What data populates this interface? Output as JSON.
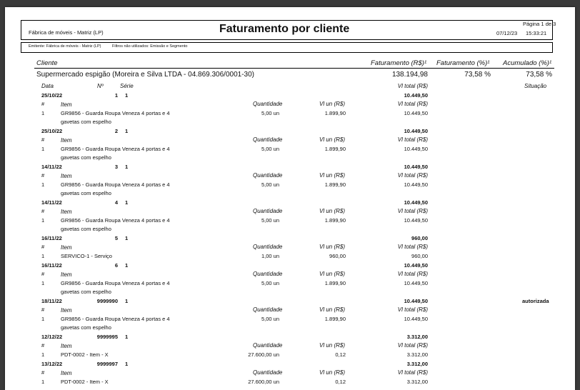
{
  "header": {
    "company": "Fábrica de móveis - Matriz (LP)",
    "title": "Faturamento por cliente",
    "page": "Página 1 de 3",
    "date": "07/12/23",
    "time": "15:33:21"
  },
  "filters": {
    "emitente": "Emitente: Fábrica de móveis - Matriz (LP)",
    "unused": "Filtros não utilizados: Emissão e Segmento"
  },
  "columns": {
    "cliente": "Cliente",
    "faturamento_rs": "Faturamento (R$)¹",
    "faturamento_pct": "Faturamento (%)¹",
    "acumulado_pct": "Acumulado (%)¹"
  },
  "client_row": {
    "name": "Supermercado espigão (Moreira e Silva LTDA - 04.869.306/0001-30)",
    "faturamento": "138.194,98",
    "faturamento_pct": "73,58 %",
    "acumulado_pct": "73,58 %"
  },
  "invoice_header": {
    "data": "Data",
    "numero": "Nº",
    "serie": "Série",
    "vl_total": "Vl total (R$)",
    "situacao": "Situação"
  },
  "item_header": {
    "num": "#",
    "item": "Item",
    "quantidade": "Quantidade",
    "vl_un": "Vl un (R$)",
    "vl_total": "Vl total (R$)"
  },
  "invoices": [
    {
      "date": "25/10/22",
      "number": "1",
      "serie": "1",
      "total": "10.449,50",
      "status": "",
      "items": [
        {
          "n": "1",
          "desc": "GR9856 - Guarda Roupa Veneza 4 portas e 4",
          "desc2": "gavetas com espelho",
          "qty": "5,00 un",
          "unit": "1.899,90",
          "total": "10.449,50"
        }
      ]
    },
    {
      "date": "25/10/22",
      "number": "2",
      "serie": "1",
      "total": "10.449,50",
      "status": "",
      "items": [
        {
          "n": "1",
          "desc": "GR9856 - Guarda Roupa Veneza 4 portas e 4",
          "desc2": "gavetas com espelho",
          "qty": "5,00 un",
          "unit": "1.899,90",
          "total": "10.449,50"
        }
      ]
    },
    {
      "date": "14/11/22",
      "number": "3",
      "serie": "1",
      "total": "10.449,50",
      "status": "",
      "items": [
        {
          "n": "1",
          "desc": "GR9856 - Guarda Roupa Veneza 4 portas e 4",
          "desc2": "gavetas com espelho",
          "qty": "5,00 un",
          "unit": "1.899,90",
          "total": "10.449,50"
        }
      ]
    },
    {
      "date": "14/11/22",
      "number": "4",
      "serie": "1",
      "total": "10.449,50",
      "status": "",
      "items": [
        {
          "n": "1",
          "desc": "GR9856 - Guarda Roupa Veneza 4 portas e 4",
          "desc2": "gavetas com espelho",
          "qty": "5,00 un",
          "unit": "1.899,90",
          "total": "10.449,50"
        }
      ]
    },
    {
      "date": "16/11/22",
      "number": "5",
      "serie": "1",
      "total": "960,00",
      "status": "",
      "items": [
        {
          "n": "1",
          "desc": "SERVICO-1 - Serviço",
          "desc2": "",
          "qty": "1,00 un",
          "unit": "960,00",
          "total": "960,00"
        }
      ]
    },
    {
      "date": "16/11/22",
      "number": "6",
      "serie": "1",
      "total": "10.449,50",
      "status": "",
      "items": [
        {
          "n": "1",
          "desc": "GR9856 - Guarda Roupa Veneza 4 portas e 4",
          "desc2": "gavetas com espelho",
          "qty": "5,00 un",
          "unit": "1.899,90",
          "total": "10.449,50"
        }
      ]
    },
    {
      "date": "18/11/22",
      "number": "9999990",
      "serie": "1",
      "total": "10.449,50",
      "status": "autorizada",
      "items": [
        {
          "n": "1",
          "desc": "GR9856 - Guarda Roupa Veneza 4 portas e 4",
          "desc2": "gavetas com espelho",
          "qty": "5,00 un",
          "unit": "1.899,90",
          "total": "10.449,50"
        }
      ]
    },
    {
      "date": "12/12/22",
      "number": "9999995",
      "serie": "1",
      "total": "3.312,00",
      "status": "",
      "items": [
        {
          "n": "1",
          "desc": "PDT-0002 - Item - X",
          "desc2": "",
          "qty": "27.600,00 un",
          "unit": "0,12",
          "total": "3.312,00"
        }
      ]
    },
    {
      "date": "13/12/22",
      "number": "9999997",
      "serie": "1",
      "total": "3.312,00",
      "status": "",
      "items": [
        {
          "n": "1",
          "desc": "PDT-0002 - Item - X",
          "desc2": "",
          "qty": "27.600,00 un",
          "unit": "0,12",
          "total": "3.312,00"
        }
      ]
    }
  ]
}
